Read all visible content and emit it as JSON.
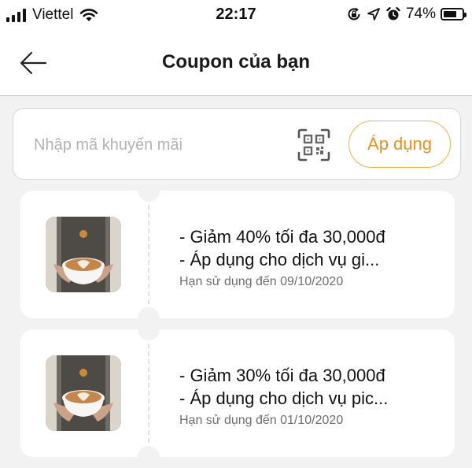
{
  "status_bar": {
    "carrier": "Viettel",
    "time": "22:17",
    "battery_percent": "74%",
    "battery_level": 0.74,
    "icons": [
      "signal-bars-icon",
      "wifi-icon",
      "screen-rotation-lock-icon",
      "location-arrow-icon",
      "alarm-clock-icon",
      "battery-icon"
    ]
  },
  "header": {
    "title": "Coupon của bạn",
    "back_icon": "arrow-left-icon"
  },
  "promo": {
    "placeholder": "Nhập mã khuyến mãi",
    "value": "",
    "qr_icon": "qr-scan-icon",
    "apply_label": "Áp dụng"
  },
  "colors": {
    "accent": "#f2b24e",
    "accent_text": "#e8921d",
    "background": "#f2f2f2",
    "card": "#ffffff"
  },
  "coupons": [
    {
      "line1": "- Giảm 40% tối đa 30,000đ",
      "line2": "- Áp dụng cho dịch vụ  gi...",
      "expiry": "Hạn sử dụng đến 09/10/2020",
      "image": "latte-art-cup-photo"
    },
    {
      "line1": "- Giảm 30% tối đa 30,000đ",
      "line2": "- Áp dụng cho dịch vụ pic...",
      "expiry": "Hạn sử dụng đến 01/10/2020",
      "image": "latte-art-cup-photo"
    }
  ]
}
